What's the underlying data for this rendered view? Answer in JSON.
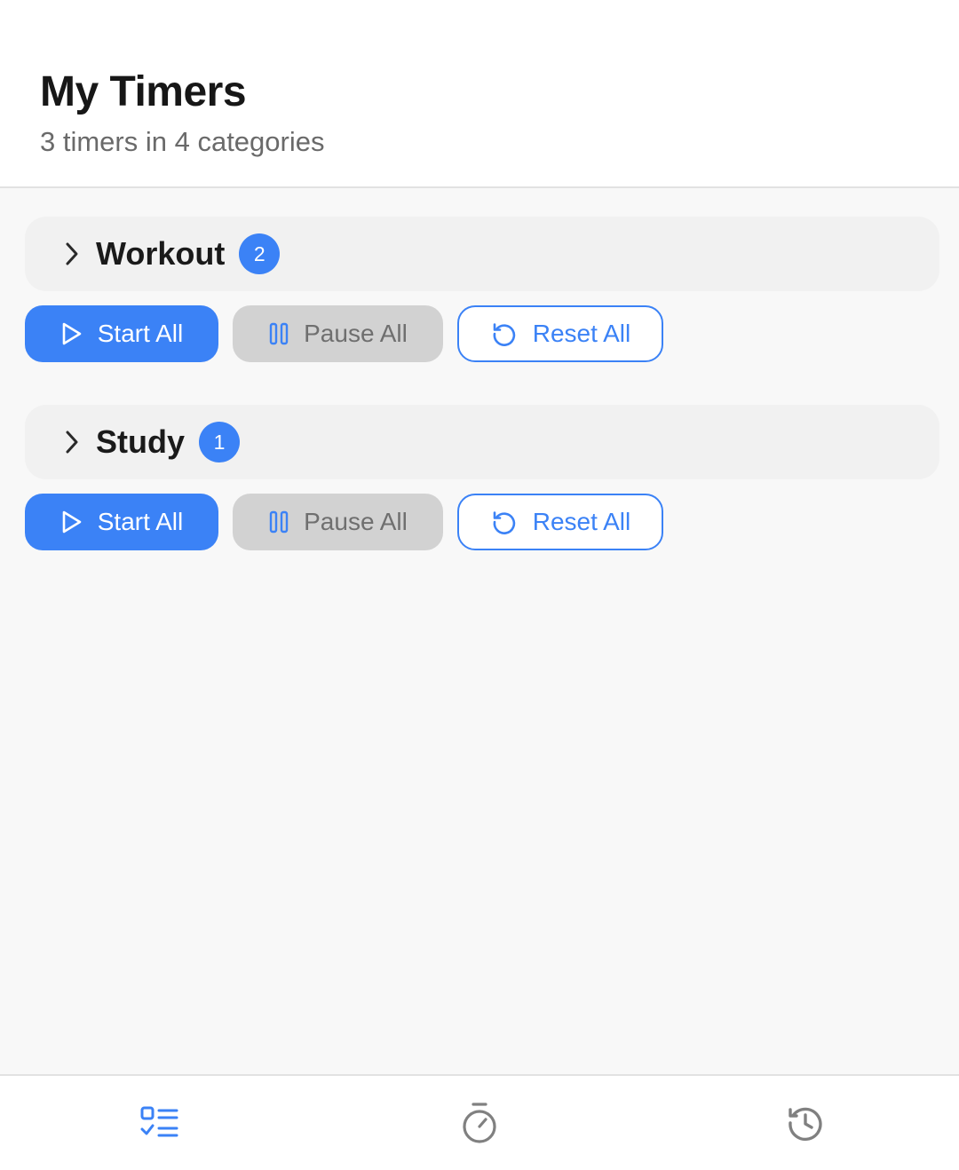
{
  "header": {
    "title": "My Timers",
    "subtitle": "3 timers in 4 categories"
  },
  "categories": [
    {
      "name": "Workout",
      "count": "2",
      "expanded": false,
      "actions": {
        "start": "Start All",
        "pause": "Pause All",
        "reset": "Reset All"
      }
    },
    {
      "name": "Study",
      "count": "1",
      "expanded": false,
      "actions": {
        "start": "Start All",
        "pause": "Pause All",
        "reset": "Reset All"
      }
    }
  ],
  "tabbar": {
    "items": [
      {
        "icon": "timer-list-icon",
        "active": true
      },
      {
        "icon": "stopwatch-icon",
        "active": false
      },
      {
        "icon": "history-icon",
        "active": false
      }
    ]
  },
  "colors": {
    "accent": "#3b82f6",
    "inactive_icon": "#808080",
    "disabled_button": "#d2d2d2"
  }
}
